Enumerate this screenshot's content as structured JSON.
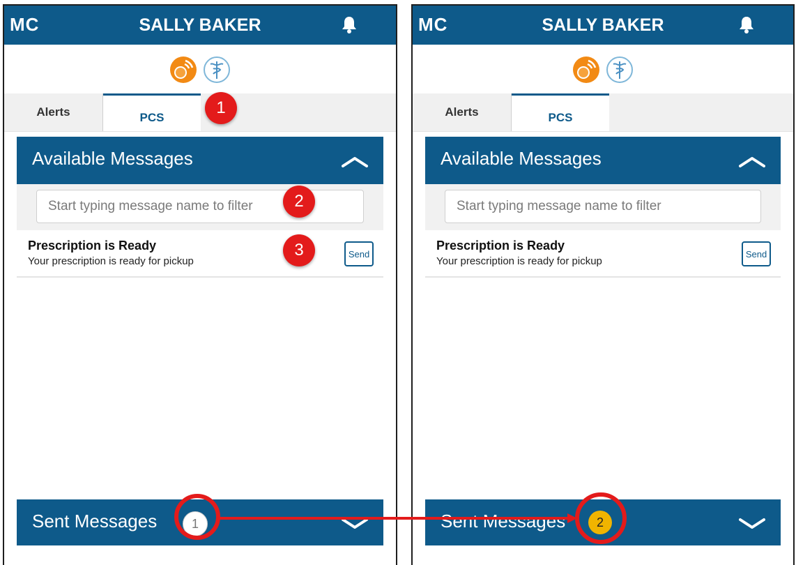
{
  "header": {
    "logo": "MC",
    "user": "SALLY BAKER"
  },
  "tabs": {
    "alerts": "Alerts",
    "pcs": "PCS"
  },
  "available": {
    "title": "Available Messages",
    "filter_placeholder": "Start typing message name to filter",
    "message": {
      "title": "Prescription is Ready",
      "subtitle": "Your prescription is ready for pickup",
      "send": "Send"
    }
  },
  "sent": {
    "title": "Sent Messages",
    "count_left": "1",
    "count_right": "2"
  },
  "callouts": [
    "1",
    "2",
    "3"
  ],
  "colors": {
    "brand": "#0e5a8a",
    "callout": "#e31b1b",
    "badge_new": "#f0b400"
  }
}
